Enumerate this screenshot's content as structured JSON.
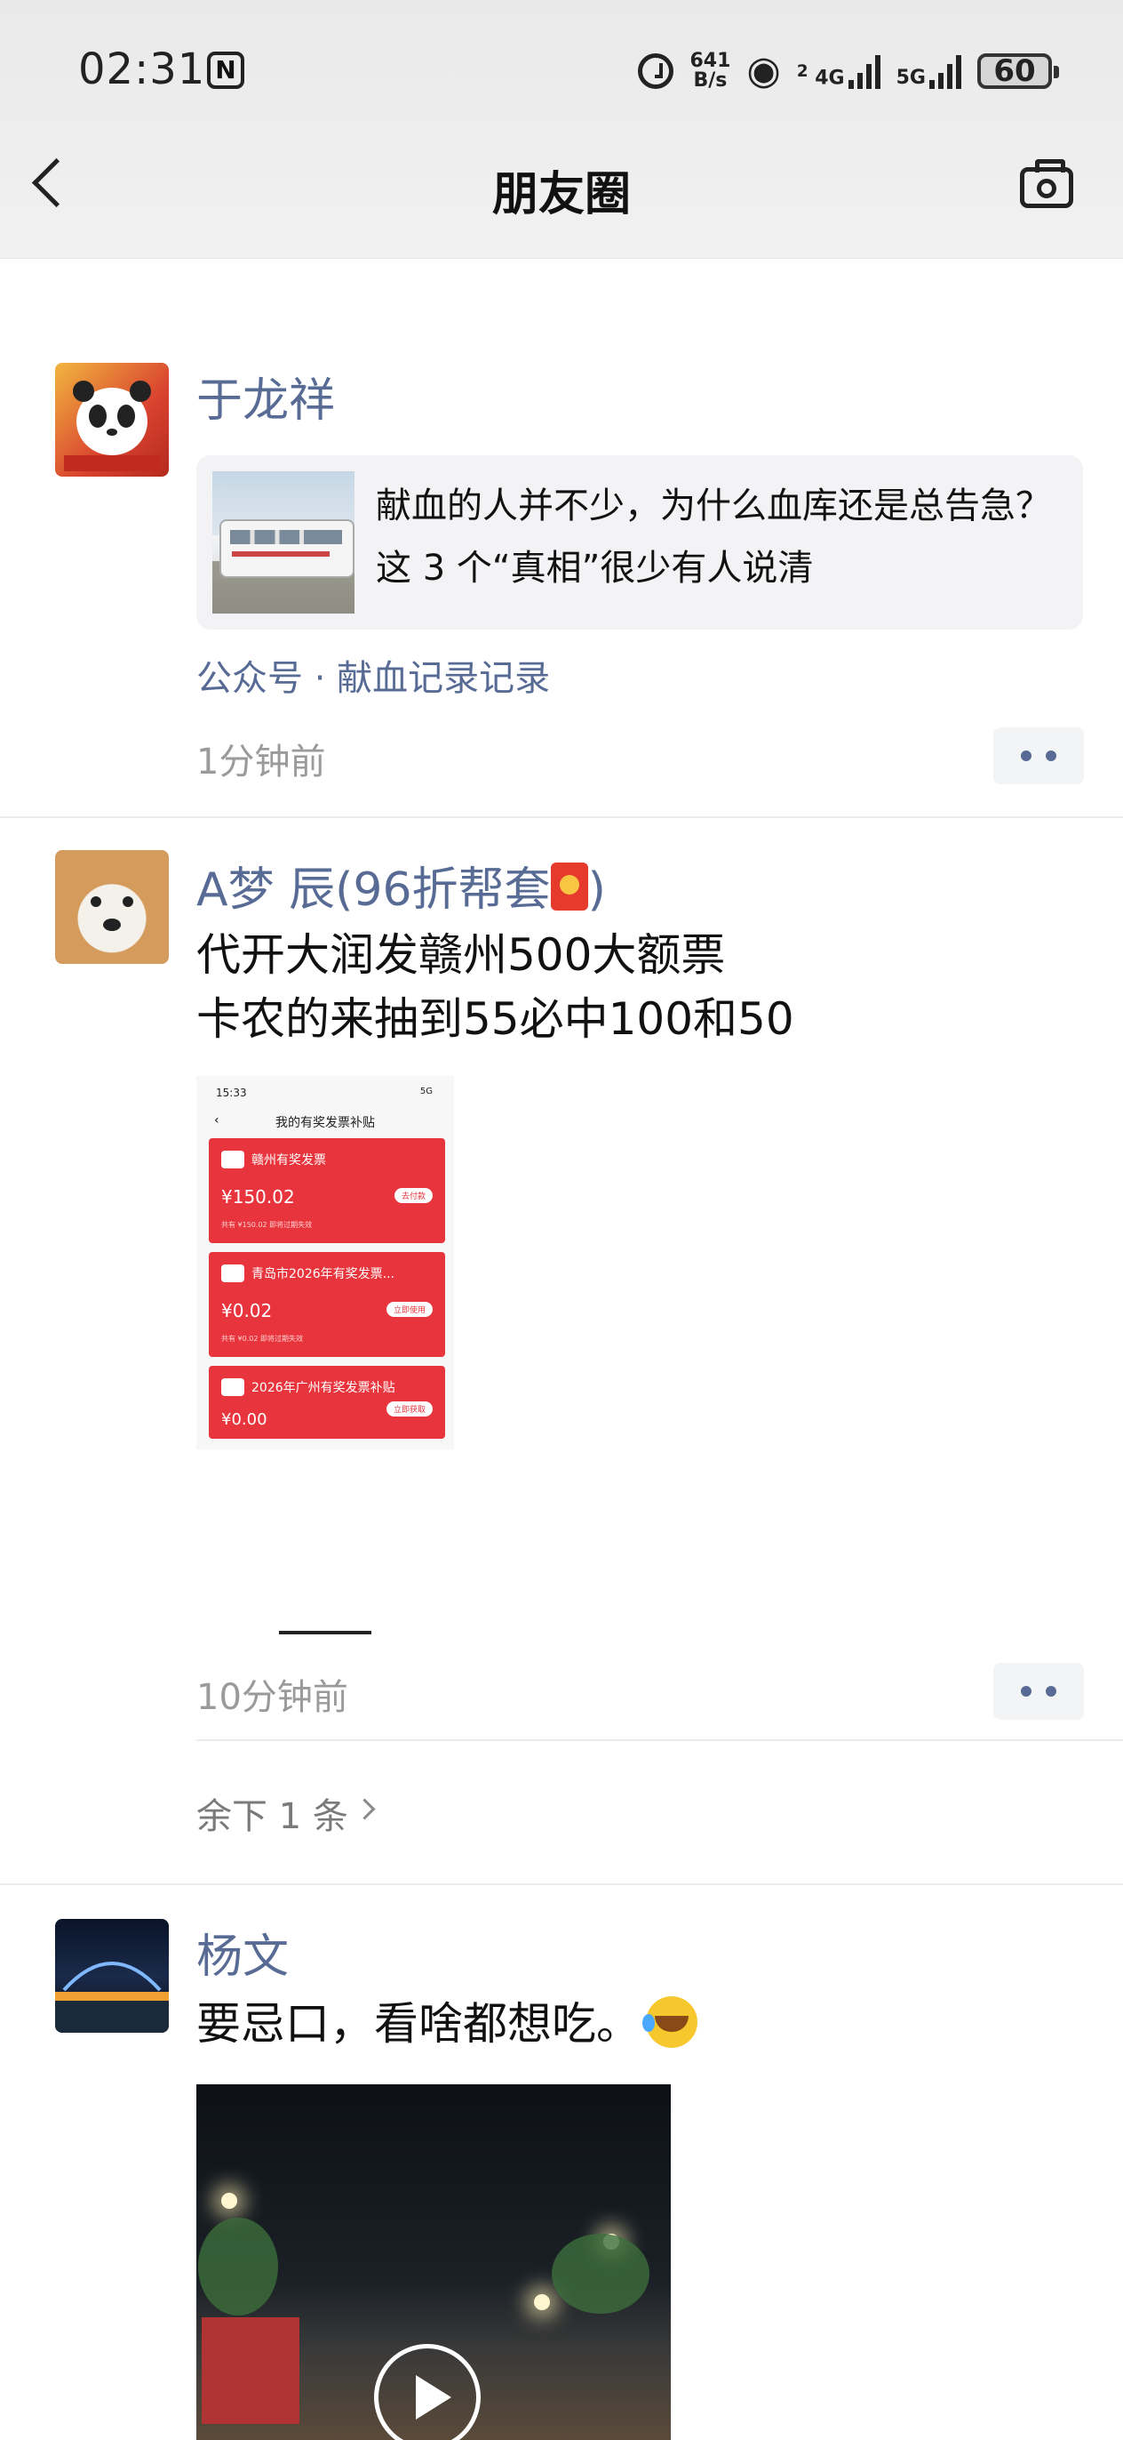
{
  "status_bar": {
    "time": "02:31",
    "nfc_label": "N",
    "net_speed_top": "641",
    "net_speed_bottom": "B/s",
    "sim1_badge": "2",
    "sim1_tech": "4G",
    "sim2_tech": "5G",
    "battery": "60",
    "icons": [
      "nfc-icon",
      "alarm-icon",
      "hotspot-icon",
      "signal-icon",
      "battery-icon"
    ]
  },
  "nav": {
    "title": "朋友圈",
    "back_icon": "back-chevron-icon",
    "camera_icon": "camera-icon"
  },
  "posts": [
    {
      "author": "于龙祥",
      "share": {
        "title": "献血的人并不少，为什么血库还是总告急？这 3 个“真相”很少有人说清"
      },
      "source": "公众号 · 献血记录记录",
      "time": "1分钟前"
    },
    {
      "author": "A梦 辰(96折帮套",
      "author_suffix": ")",
      "text_line1": "代开大润发赣州500大额票",
      "text_line2": "卡农的来抽到55必中100和50",
      "screenshot": {
        "status_time": "15:33",
        "status_right": "5G",
        "title": "我的有奖发票补贴",
        "cards": [
          {
            "name": "赣州有奖发票",
            "amount": "¥150.02",
            "button": "去付款",
            "footer": "共有 ¥150.02 即将过期失效"
          },
          {
            "name": "青岛市2026年有奖发票...",
            "amount": "¥0.02",
            "button": "立即使用",
            "footer": "共有 ¥0.02 即将过期失效"
          },
          {
            "name": "2026年广州有奖发票补贴",
            "amount": "¥0.00",
            "button": "立即获取"
          }
        ]
      },
      "time": "10分钟前",
      "remaining": "余下 1 条"
    },
    {
      "author": "杨文",
      "text": "要忌口，看啥都想吃。"
    }
  ]
}
